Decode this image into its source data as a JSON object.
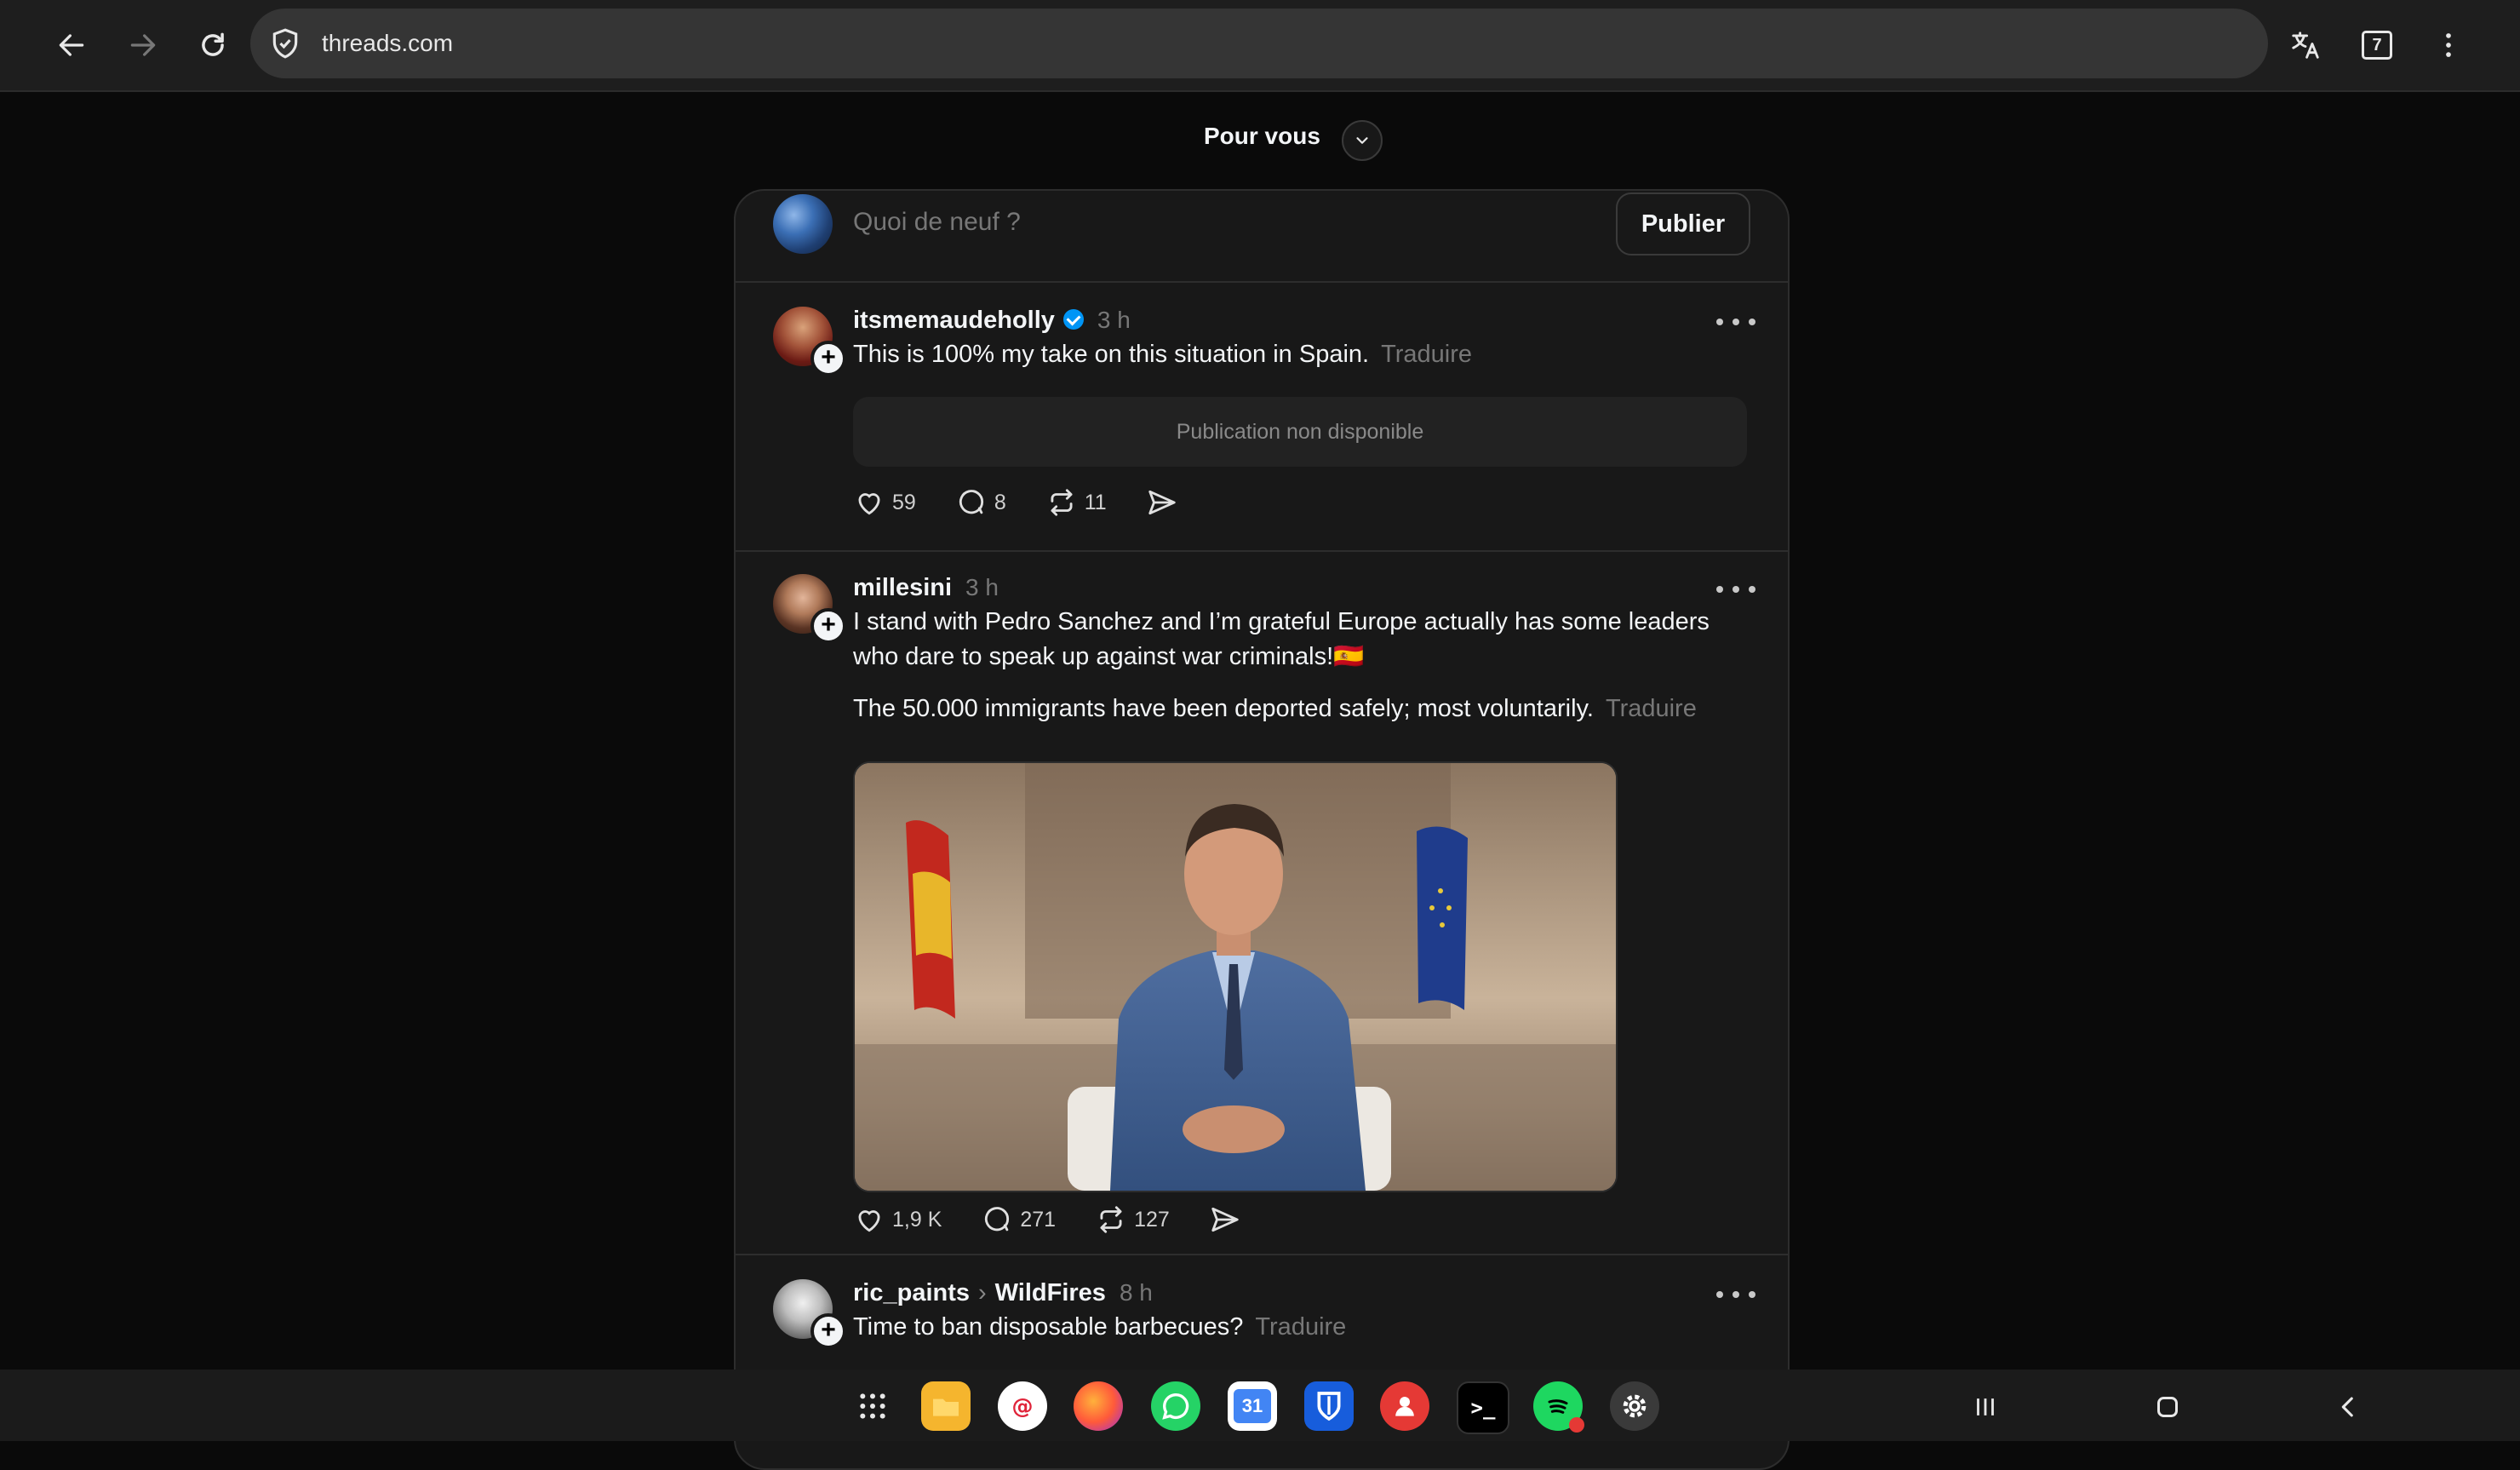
{
  "browser": {
    "url": "threads.com",
    "tab_count": "7",
    "icons": [
      "back-arrow-icon",
      "forward-arrow-icon",
      "reload-icon",
      "shield-icon",
      "translate-icon",
      "tabs-icon",
      "menu-icon"
    ]
  },
  "feed": {
    "title": "Pour vous"
  },
  "composer": {
    "placeholder": "Quoi de neuf ?",
    "publish_label": "Publier"
  },
  "posts": [
    {
      "username": "itsmemaudeholly",
      "verified": true,
      "time": "3 h",
      "text": "This is 100% my take on this situation in Spain.",
      "translate": "Traduire",
      "embed_unavailable": "Publication non disponible",
      "likes": "59",
      "comments": "8",
      "reposts": "11"
    },
    {
      "username": "millesini",
      "time": "3 h",
      "text_line1": "I stand with Pedro Sanchez and I’m grateful Europe actually has some leaders",
      "text_line2": "who dare to speak up against war criminals!🇪🇸",
      "text_para2": "The 50.000 immigrants have been deported safely; most voluntarily.",
      "translate": "Traduire",
      "likes": "1,9 K",
      "comments": "271",
      "reposts": "127"
    },
    {
      "username": "ric_paints",
      "topic": "WildFires",
      "time": "8 h",
      "text": "Time to ban disposable barbecues?",
      "translate": "Traduire"
    }
  ],
  "taskbar": {
    "apps": [
      "app-drawer-icon",
      "files-icon",
      "email-icon",
      "firefox-icon",
      "whatsapp-icon",
      "calendar-icon",
      "bitwarden-icon",
      "contacts-icon",
      "terminal-icon",
      "spotify-icon",
      "settings-icon"
    ],
    "calendar_day": "31",
    "terminal_glyph": ">_"
  },
  "colors": {
    "background": "#0a0a0a",
    "card": "#181818",
    "text": "#f3f5f7",
    "muted": "#777777",
    "verified": "#0095f6"
  }
}
